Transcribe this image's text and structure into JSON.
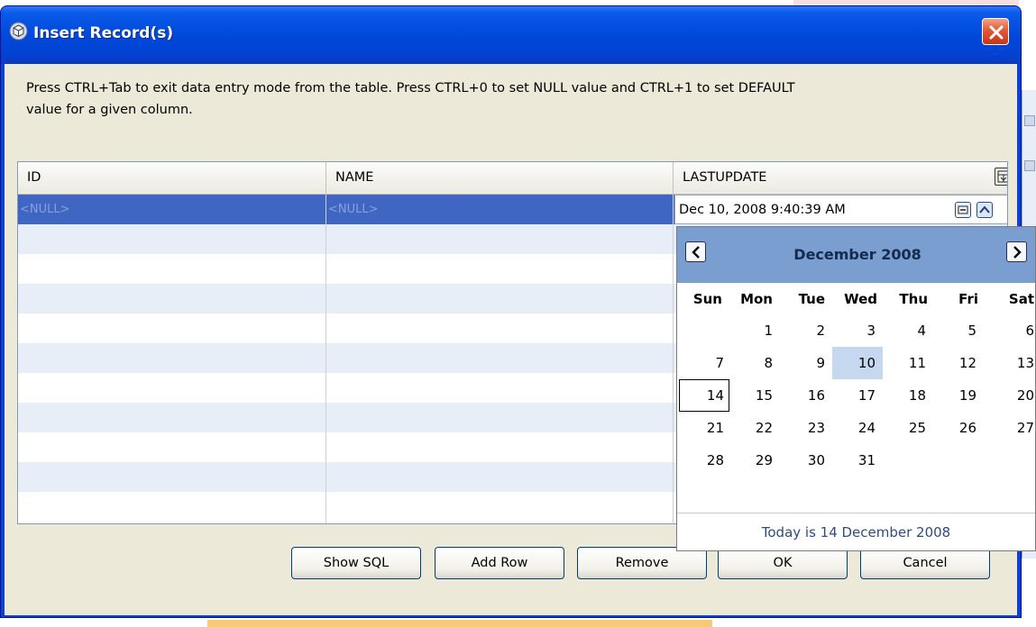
{
  "window": {
    "title": "Insert Record(s)",
    "icon": "database-cube-icon",
    "close_icon": "close-icon",
    "colors": {
      "titlebar": "#0047da",
      "client": "#ece9d8",
      "close": "#e05a36"
    }
  },
  "hint": {
    "line1": "Press CTRL+Tab to exit data entry mode from the table. Press CTRL+0 to set NULL value and CTRL+1 to set DEFAULT",
    "line2": "value for a given column."
  },
  "table": {
    "columns": [
      "ID",
      "NAME",
      "LASTUPDATE"
    ],
    "rows": [
      {
        "id": "<NULL>",
        "name": "<NULL>",
        "lastupdate": "Dec 10, 2008 9:40:39 AM"
      }
    ],
    "selection_color": "#3f66c3",
    "stripe_color": "#e8eef7"
  },
  "buttons": {
    "show_sql": "Show SQL",
    "add_row": "Add Row",
    "remove": "Remove",
    "ok": "OK",
    "cancel": "Cancel"
  },
  "calendar": {
    "month_label": "December 2008",
    "weekdays": [
      "Sun",
      "Mon",
      "Tue",
      "Wed",
      "Thu",
      "Fri",
      "Sat"
    ],
    "weeks": [
      [
        "",
        "1",
        "2",
        "3",
        "4",
        "5",
        "6"
      ],
      [
        "7",
        "8",
        "9",
        "10",
        "11",
        "12",
        "13"
      ],
      [
        "14",
        "15",
        "16",
        "17",
        "18",
        "19",
        "20"
      ],
      [
        "21",
        "22",
        "23",
        "24",
        "25",
        "26",
        "27"
      ],
      [
        "28",
        "29",
        "30",
        "31",
        "",
        "",
        ""
      ]
    ],
    "selected_day": "10",
    "today_day": "14",
    "today_text": "Today is  14 December 2008",
    "header_color": "#7a9ecf",
    "selected_color": "#c5d8ef"
  }
}
